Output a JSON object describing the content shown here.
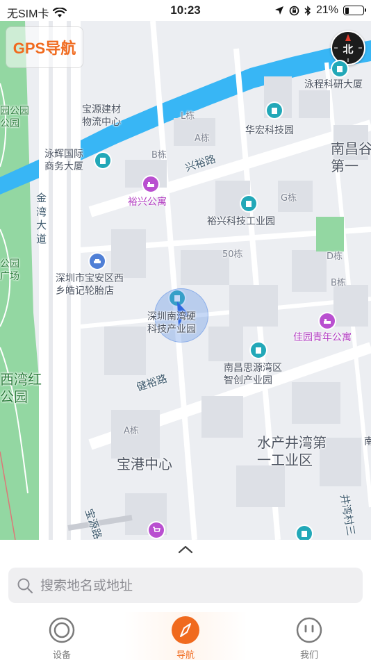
{
  "status_bar": {
    "carrier": "无SIM卡",
    "time": "10:23",
    "battery": "21%",
    "battery_level": 0.21
  },
  "app": {
    "title": "GPS导航",
    "accent": "#f06a1e"
  },
  "compass": {
    "label": "北"
  },
  "map": {
    "labels": {
      "yongcheng": "泳程科研大厦",
      "baoyuan": "宝源建材\n物流中心",
      "l_dong": "L栋",
      "a_dong_top": "A栋",
      "huahong": "华宏科技园",
      "yonghui": "泳辉国际\n商务大厦",
      "b_dong": "B栋",
      "xingyu_road": "兴裕路",
      "nanchang_top": "南昌谷\n第一",
      "yuxing_apt": "裕兴公寓",
      "g_dong": "G栋",
      "yuxing_park": "裕兴科技工业园",
      "jinwan_road": "金湾大道",
      "dong50": "50栋",
      "d_dong": "D栋",
      "b_dong_right": "B栋",
      "tyre_shop": "深圳市宝安区西\n乡皓记轮胎店",
      "tech_park": "深圳南湾硬\n科技产业园",
      "jiayuan": "佳园青年公寓",
      "nanchang_siyuan": "南昌思源湾区\n智创产业园",
      "jianyu_road": "健裕路",
      "a_dong_bottom": "A栋",
      "shuichan": "水产井湾第\n一工业区",
      "baogang": "宝港中心",
      "baoyuan_road": "宝源路",
      "jingwan_road": "井湾村三",
      "park_left_top": "园公园\n公园",
      "park_left_mid": "公园\n广场",
      "xiwan_park": "西湾红\n公园",
      "edge_right": "南"
    }
  },
  "search": {
    "placeholder": "搜索地名或地址"
  },
  "tabs": [
    {
      "label": "设备"
    },
    {
      "label": "导航"
    },
    {
      "label": "我们"
    }
  ]
}
